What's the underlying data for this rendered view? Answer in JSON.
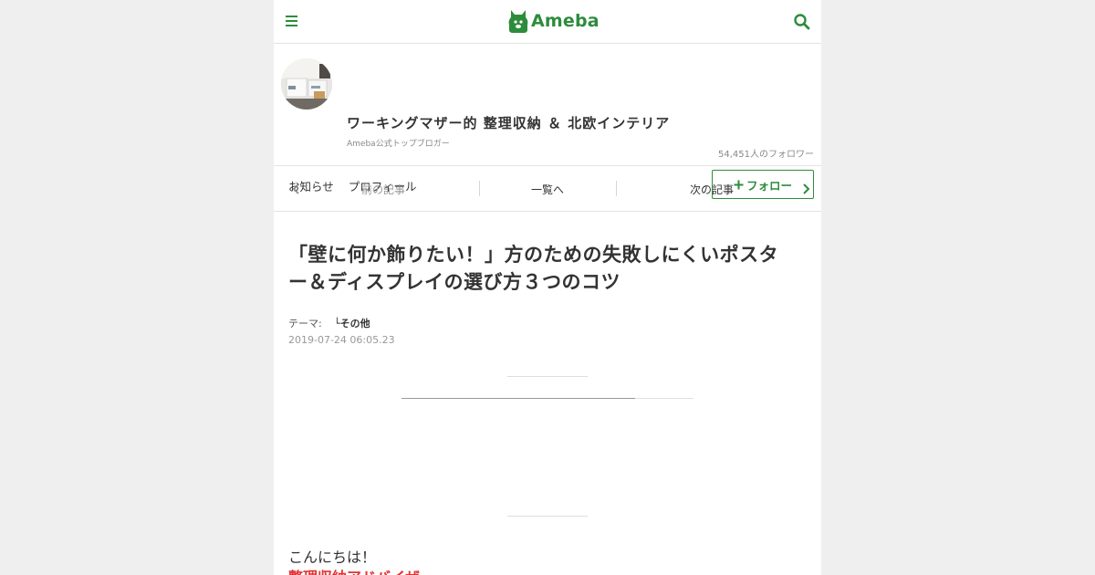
{
  "header": {
    "menu_icon": "hamburger-menu-icon",
    "logo_text": "Ameba",
    "search_icon": "search-icon",
    "accent_color": "#2d8c3c"
  },
  "blog": {
    "title": "ワーキングマザー的 整理収納 ＆ 北欧インテリア",
    "badge": "Ameba公式トップブロガー",
    "followers": "54,451人のフォロワー",
    "links": [
      "お知らせ",
      "プロフィール"
    ],
    "follow_label": "フォロー",
    "follow_icon": "plus-icon"
  },
  "article_nav": {
    "prev_label": "前の記事",
    "list_label": "一覧へ",
    "next_label": "次の記事"
  },
  "article": {
    "title_line1": "「壁に何か飾りたい！」方のための失敗しにくいポスタ",
    "title_line2": "ー＆ディスプレイの選び方３つのコツ",
    "theme_label": "テーマ:",
    "theme_value": "└その他",
    "date": "2019-07-24 06:05.23",
    "greeting": "こんにちは！",
    "highlight": "整理収納アドバイザー"
  }
}
